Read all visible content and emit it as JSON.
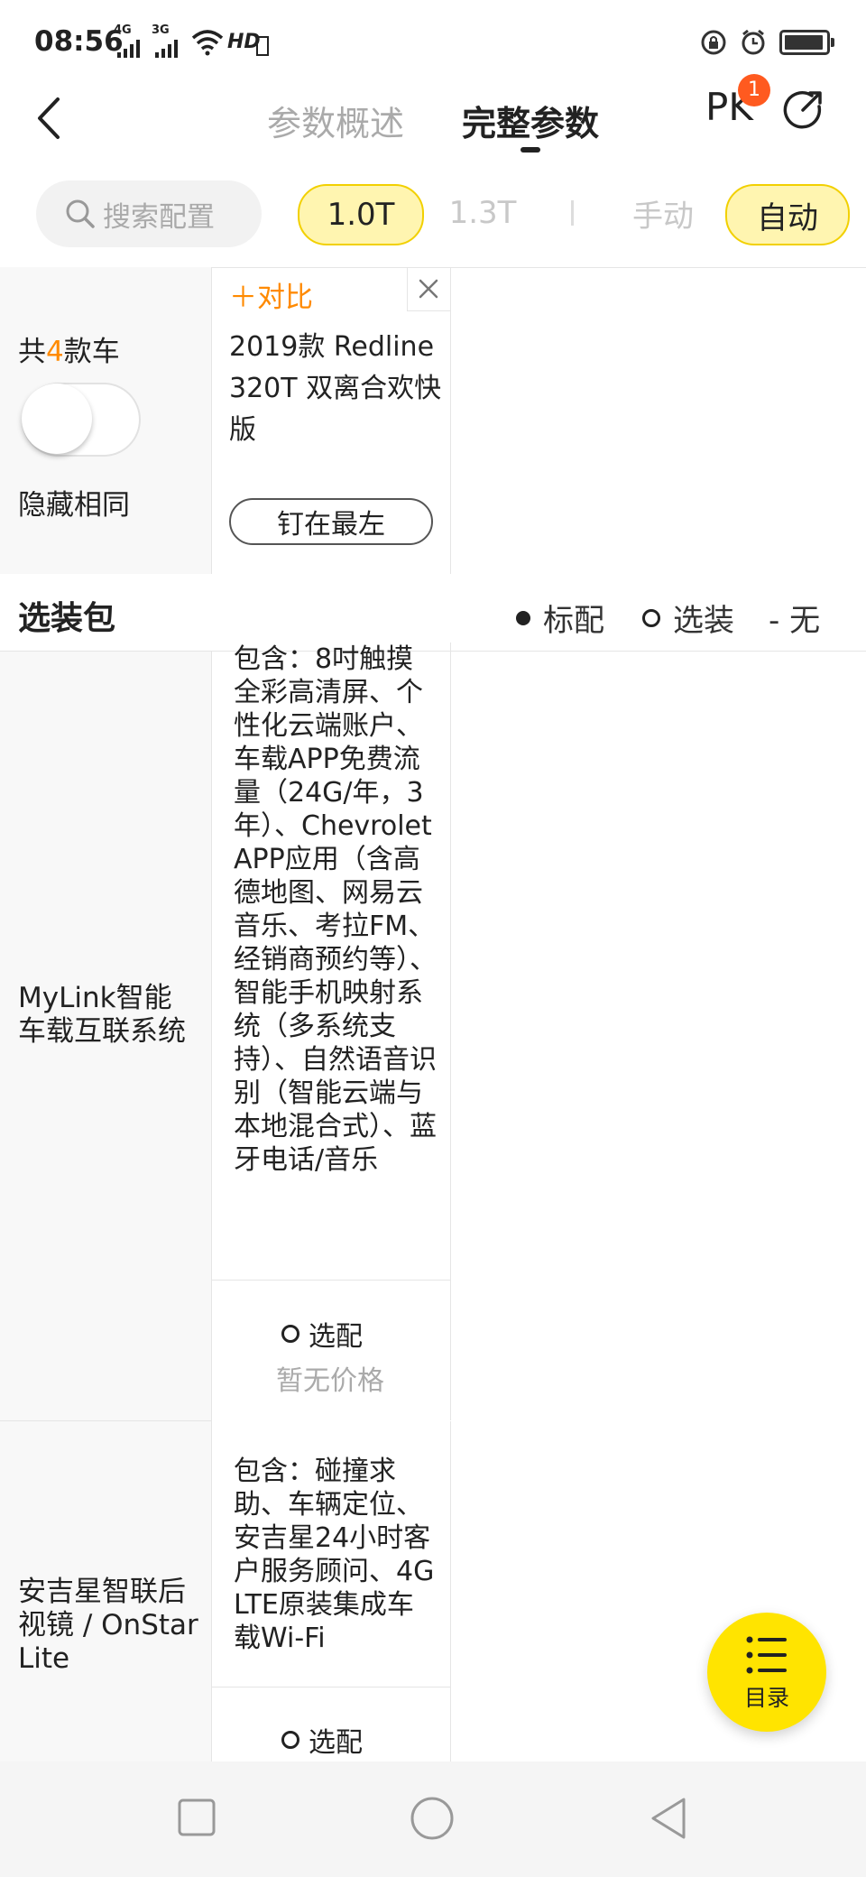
{
  "status_bar": {
    "time": "08:56",
    "network_1": "4G",
    "network_2": "3G",
    "hd": "HD"
  },
  "header": {
    "tabs": [
      {
        "label": "参数概述",
        "active": false
      },
      {
        "label": "完整参数",
        "active": true
      }
    ],
    "pk_label": "PK",
    "pk_badge": "1"
  },
  "filters": {
    "search_placeholder": "搜索配置",
    "displacement": [
      {
        "label": "1.0T",
        "selected": true
      },
      {
        "label": "1.3T",
        "selected": false
      }
    ],
    "transmission": [
      {
        "label": "手动",
        "selected": false
      },
      {
        "label": "自动",
        "selected": true
      }
    ]
  },
  "summary": {
    "count_prefix": "共",
    "count": "4",
    "count_suffix": "款车",
    "hide_same_label": "隐藏相同",
    "hide_same_on": false
  },
  "car": {
    "compare_label": "＋对比",
    "name": "2019款 Redline 320T 双离合欢快版",
    "pin_label": "钉在最左"
  },
  "section": {
    "title": "选装包",
    "legend": {
      "standard": "标配",
      "optional": "选装",
      "none": "- 无"
    }
  },
  "rows": [
    {
      "label": "MyLink智能车载互联系统",
      "content": "包含：8吋触摸全彩高清屏、个性化云端账户、车载APP免费流量（24G/年，3年）、Chevrolet APP应用（含高德地图、网易云音乐、考拉FM、经销商预约等）、智能手机映射系统（多系统支持）、自然语音识别（智能云端与本地混合式）、蓝牙电话/音乐",
      "option": "选配",
      "price": "暂无价格"
    },
    {
      "label": "安吉星智联后视镜 / OnStar Lite",
      "content": "包含：碰撞求助、车辆定位、安吉星24小时客户服务顾问、4G LTE原装集成车载Wi-Fi",
      "option": "选配"
    }
  ],
  "fab": {
    "label": "目录"
  },
  "colors": {
    "accent_orange": "#ff8a00",
    "chip_yellow": "#fff5b0",
    "fab_yellow": "#ffe400",
    "badge_red": "#ff5a1f"
  }
}
